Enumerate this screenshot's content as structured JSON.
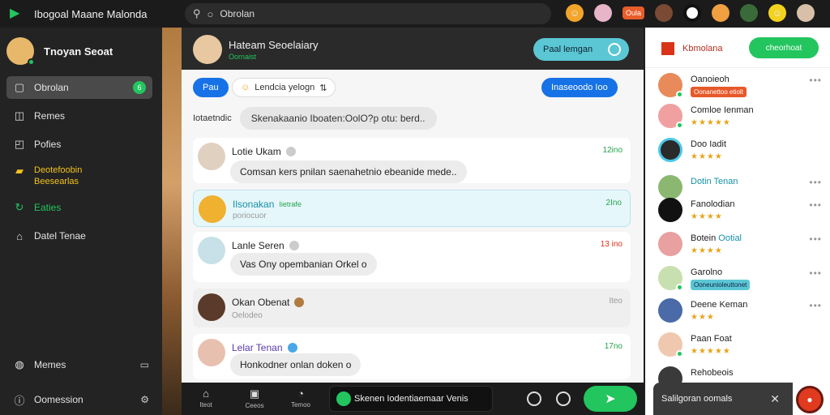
{
  "app": {
    "title": "Ibogoal Maane Malonda"
  },
  "search": {
    "value": "Obrolan"
  },
  "top_badge": "Oula",
  "colors": {
    "accent_green": "#22c55e",
    "accent_blue": "#1672e6",
    "teal": "#5bc7d4",
    "brand_red": "#d9341a",
    "sidebar_bg": "#232323"
  },
  "user": {
    "name": "Tnoyan Seoat"
  },
  "sidebar": {
    "items": [
      {
        "label": "Obrolan",
        "icon": "chat-icon",
        "count": "6",
        "active": true
      },
      {
        "label": "Remes",
        "icon": "book-icon"
      },
      {
        "label": "Pofies",
        "icon": "profile-icon"
      },
      {
        "label_line1": "Deotefoobin",
        "label_line2": "Beesearlas",
        "icon": "folder-icon",
        "style": "yellow"
      },
      {
        "label": "Eaties",
        "icon": "refresh-icon",
        "style": "green"
      },
      {
        "label": "Datel Tenae",
        "icon": "house-icon"
      }
    ],
    "bottom": [
      {
        "label": "Memes",
        "icon": "globe-icon"
      },
      {
        "label": "Oomession",
        "icon": "info-icon"
      }
    ]
  },
  "chat": {
    "header": {
      "name": "Hateam Seoelaiary",
      "subtitle": "Oornaist",
      "button": "Paal lemgan"
    },
    "chips": {
      "left": "Pau",
      "middle": "Lendcia yelogn",
      "right": "Inaseoodo Ioo"
    },
    "system": {
      "label": "Iotaetndic",
      "text": "Skenakaanio Iboaten:OolO?p otu: berd.."
    },
    "messages": [
      {
        "name": "Lotie Ukam",
        "time": "12ino",
        "text": "Comsan kers pnilan saenahetnio ebeanide mede.."
      },
      {
        "name": "Ilsonakan",
        "tag": "Iietrafe",
        "time": "2Ino",
        "text": "poriocuor"
      },
      {
        "name": "Lanle Seren",
        "time": "13 ino",
        "text": "Vas Ony opembanian Orkel o"
      },
      {
        "name": "Okan Obenat",
        "time": "Iteo",
        "text": "Oelodeo"
      },
      {
        "name": "Lelar Tenan",
        "time": "17no",
        "text": "Honkodner onlan doken o"
      }
    ]
  },
  "chatbar": {
    "items": [
      {
        "label": "Iteot",
        "icon": "home-icon"
      },
      {
        "label": "Ceeos",
        "icon": "calendar-icon"
      },
      {
        "label": "Temoo",
        "icon": "timer-icon"
      }
    ],
    "status": "Skenen Iodentiaemaar Venis"
  },
  "right_panel": {
    "title": "Kbmolana",
    "button": "cheorhoat",
    "contacts": [
      {
        "name": "Oanoieoh",
        "tag": "Oonanettoo etiolt",
        "tag_color": "#e8582a"
      },
      {
        "name": "Comloe Ienman",
        "stars": "★★★★★"
      },
      {
        "name": "Doo Iadit",
        "stars": "★★★★"
      },
      {
        "name": "Dotin Tenan",
        "teal": true
      },
      {
        "name": "Fanolodian",
        "stars": "★★★★"
      },
      {
        "name": "Botein",
        "name_extra": "Ootial",
        "stars": "★★★★"
      },
      {
        "name": "Garolno",
        "tag": "Ooneunioleuttonet",
        "tag_color": "#5bc7d4"
      },
      {
        "name": "Deene Keman",
        "stars": "★★★"
      },
      {
        "name": "Paan Foat",
        "stars": "★★★★★"
      },
      {
        "name": "Rehobeois"
      }
    ],
    "bottom_bar": "Salilgoran oomals"
  }
}
